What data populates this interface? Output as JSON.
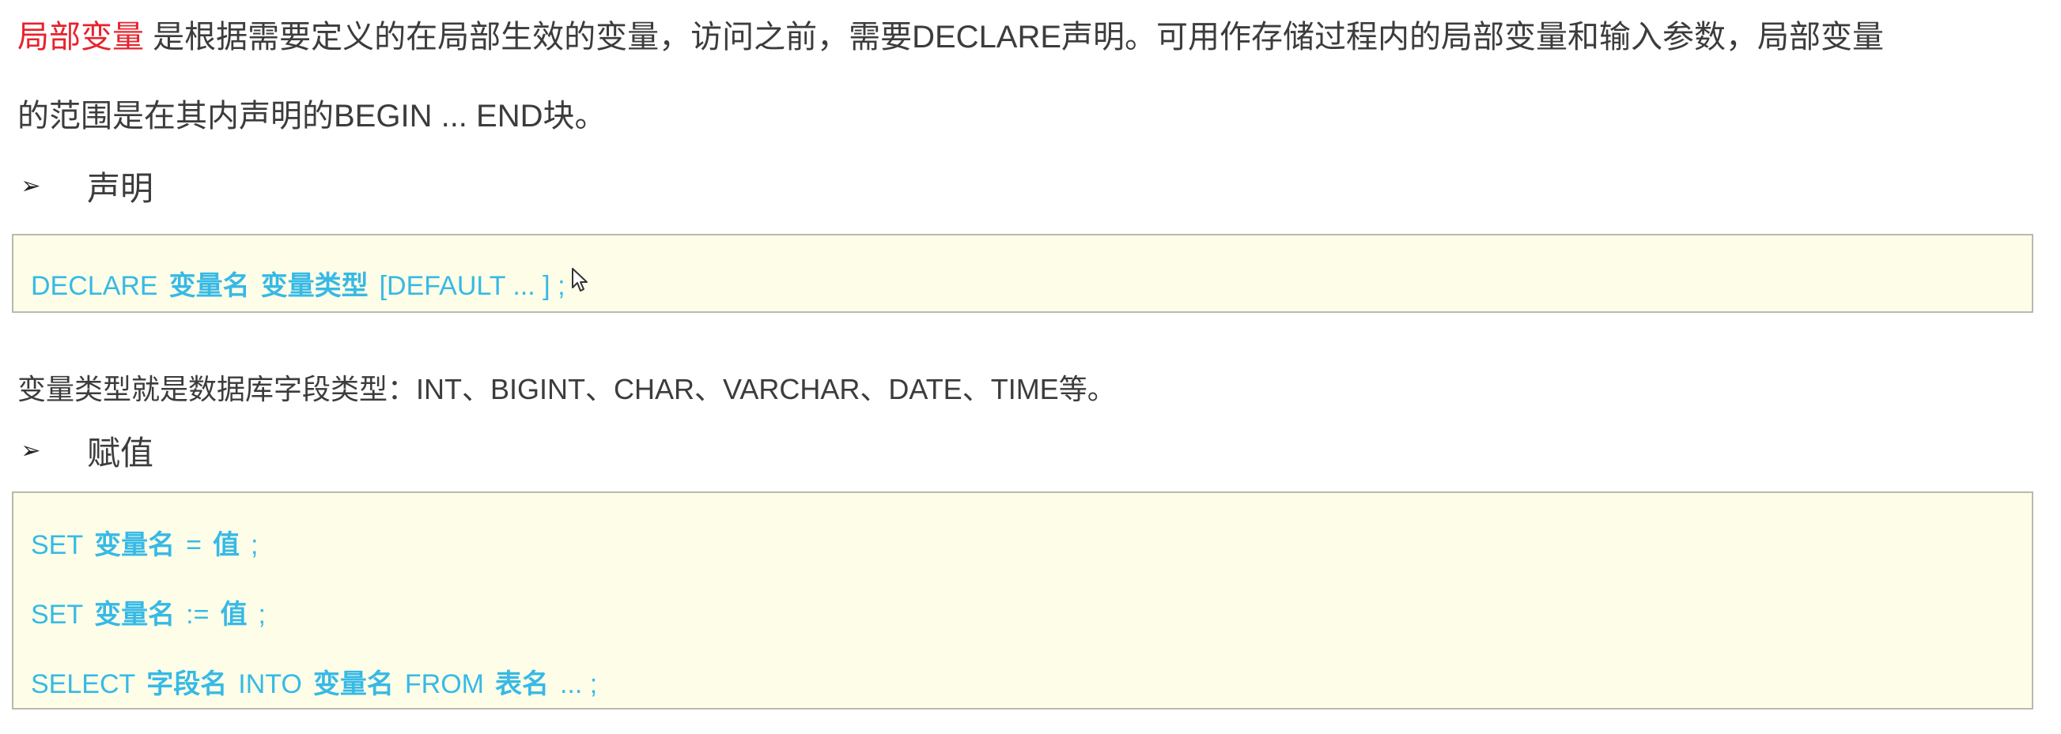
{
  "intro": {
    "highlight": "局部变量",
    "line1_rest": " 是根据需要定义的在局部生效的变量，访问之前，需要DECLARE声明。可用作存储过程内的局部变量和输入参数，局部变量",
    "line2": "的范围是在其内声明的BEGIN ... END块。"
  },
  "sections": {
    "declare": {
      "bullet_icon": "arrow-bullet-icon",
      "title": "声明",
      "code": {
        "kw1": "DECLARE",
        "ph1": "变量名",
        "ph2": "变量类型",
        "rest": "[DEFAULT ... ] ;"
      }
    },
    "note": "变量类型就是数据库字段类型：INT、BIGINT、CHAR、VARCHAR、DATE、TIME等。",
    "assign": {
      "bullet_icon": "arrow-bullet-icon",
      "title": "赋值",
      "lines": [
        {
          "kw1": "SET",
          "ph1": "变量名",
          "op": "=",
          "ph2": "值",
          "end": ";"
        },
        {
          "kw1": "SET",
          "ph1": "变量名",
          "op": ":=",
          "ph2": "值",
          "end": ";"
        },
        {
          "kw1": "SELECT",
          "ph1": "字段名",
          "kw2": "INTO",
          "ph2": "变量名",
          "kw3": "FROM",
          "ph3": "表名",
          "end": "... ;"
        }
      ]
    }
  },
  "colors": {
    "highlight": "#e8222c",
    "code_text": "#37b9e6",
    "code_bg": "#fefee8",
    "code_border": "#b9b9b0",
    "body_text": "#3c3c3c"
  }
}
